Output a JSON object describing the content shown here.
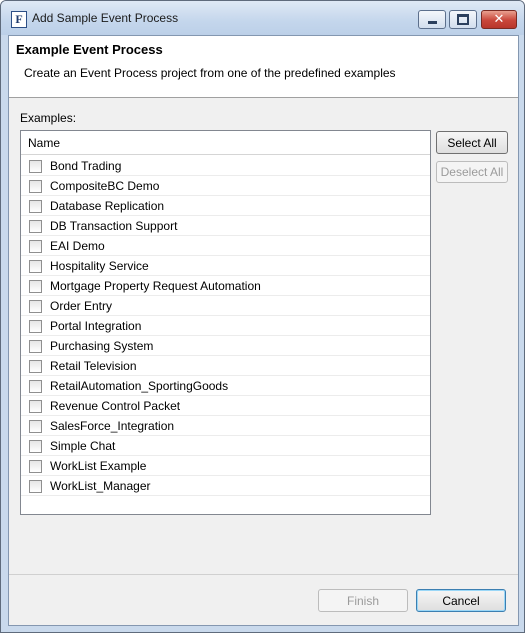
{
  "window": {
    "title": "Add Sample Event Process",
    "app_icon_letter": "F"
  },
  "banner": {
    "title": "Example Event Process",
    "description": "Create an Event Process project from one of the predefined examples"
  },
  "examples": {
    "label": "Examples:",
    "column_header": "Name",
    "items": [
      {
        "label": "Bond Trading",
        "checked": false
      },
      {
        "label": "CompositeBC Demo",
        "checked": false
      },
      {
        "label": "Database Replication",
        "checked": false
      },
      {
        "label": "DB Transaction Support",
        "checked": false
      },
      {
        "label": "EAI Demo",
        "checked": false
      },
      {
        "label": "Hospitality Service",
        "checked": false
      },
      {
        "label": "Mortgage Property Request Automation",
        "checked": false
      },
      {
        "label": "Order Entry",
        "checked": false
      },
      {
        "label": "Portal Integration",
        "checked": false
      },
      {
        "label": "Purchasing System",
        "checked": false
      },
      {
        "label": "Retail Television",
        "checked": false
      },
      {
        "label": "RetailAutomation_SportingGoods",
        "checked": false
      },
      {
        "label": "Revenue Control Packet",
        "checked": false
      },
      {
        "label": "SalesForce_Integration",
        "checked": false
      },
      {
        "label": "Simple Chat",
        "checked": false
      },
      {
        "label": "WorkList Example",
        "checked": false
      },
      {
        "label": "WorkList_Manager",
        "checked": false
      }
    ]
  },
  "buttons": {
    "select_all": "Select All",
    "deselect_all": "Deselect All",
    "finish": "Finish",
    "cancel": "Cancel"
  },
  "window_controls": {
    "close_glyph": "✕"
  }
}
